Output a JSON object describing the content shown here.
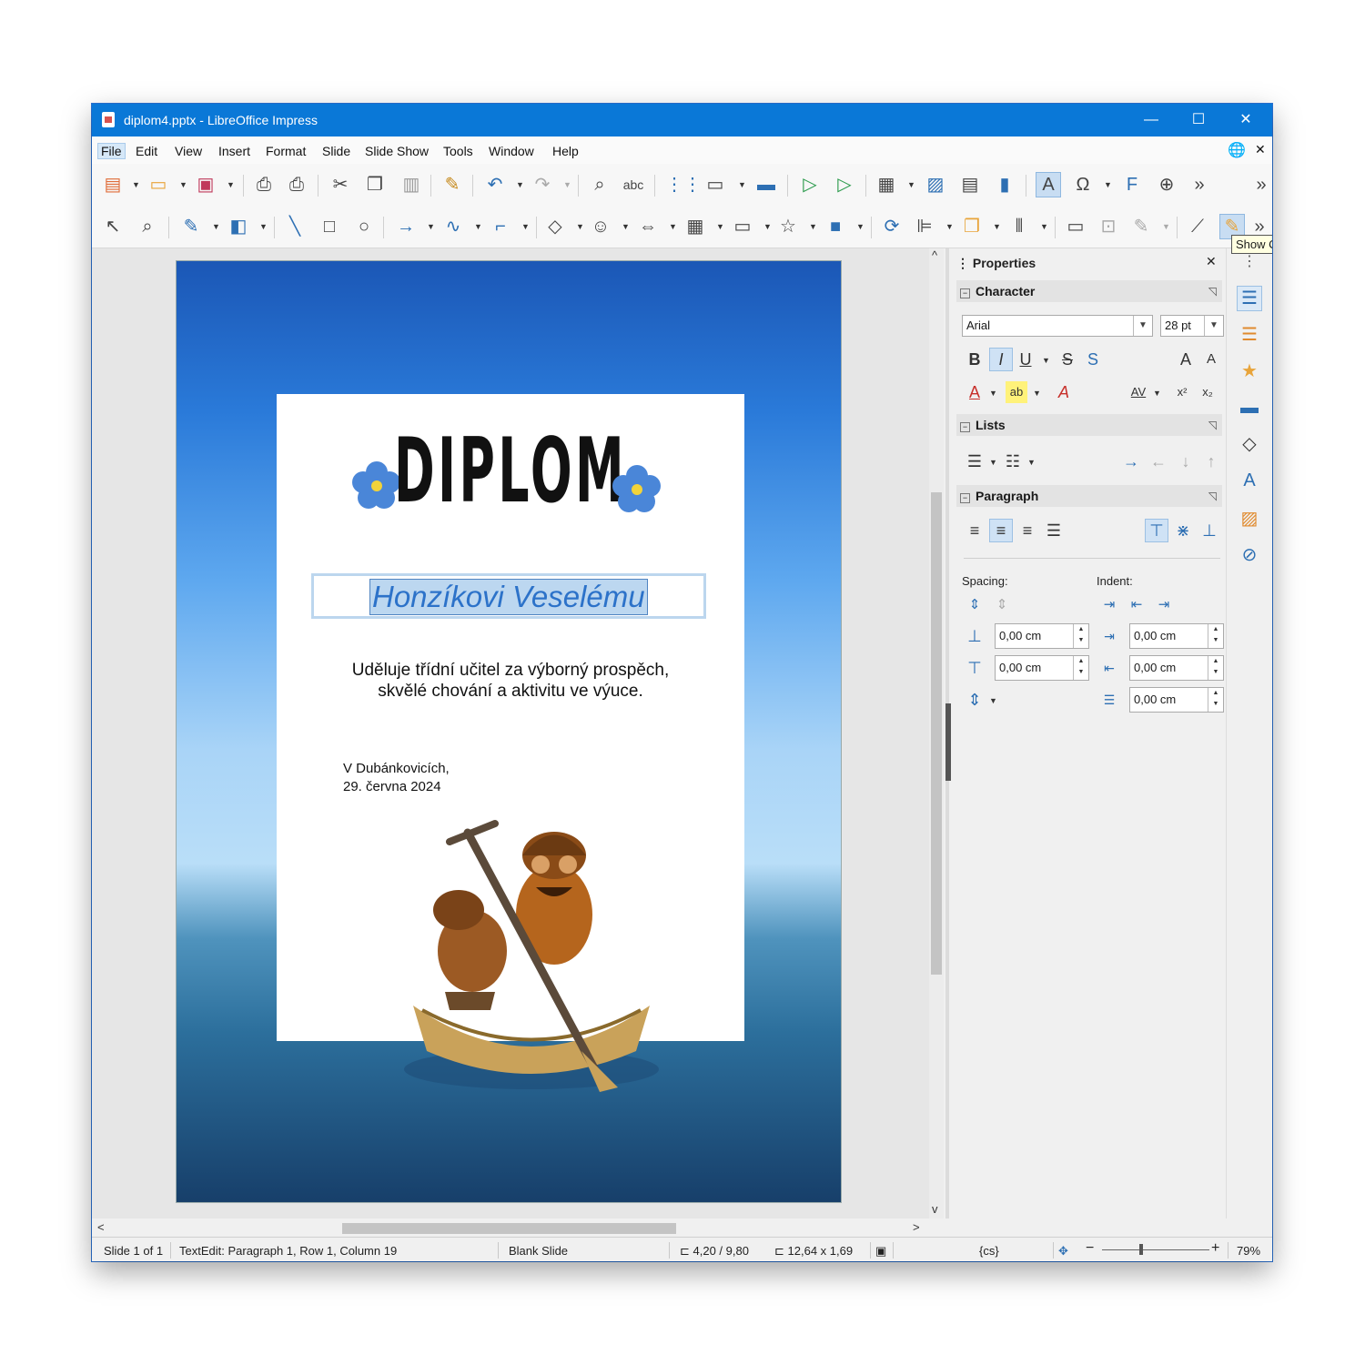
{
  "window": {
    "title": "diplom4.pptx - LibreOffice Impress",
    "minimize": "—",
    "maximize": "☐",
    "close": "✕"
  },
  "menu": {
    "items": [
      "File",
      "Edit",
      "View",
      "Insert",
      "Format",
      "Slide",
      "Slide Show",
      "Tools",
      "Window",
      "Help"
    ],
    "globe": "🌐",
    "close": "✕"
  },
  "toolbar_overflow": "»",
  "slide": {
    "title": "DIPLOM",
    "name": "Honzíkovi Veselému",
    "award_line1": "Uděluje třídní učitel za výborný prospěch,",
    "award_line2": "skvělé chování a aktivitu ve výuce.",
    "place": "V Dubánkovicích,",
    "date": "29. června 2024"
  },
  "sidebar": {
    "title": "Properties",
    "character": {
      "heading": "Character",
      "font_name": "Arial",
      "font_size": "28 pt",
      "bold": "B",
      "italic": "I",
      "underline": "U",
      "strike": "S",
      "shadow": "S",
      "grow": "A",
      "shrink": "A",
      "font_color": "A",
      "highlight": "ab",
      "clear": "A",
      "spacing": "AV",
      "superscript": "x²",
      "subscript": "x₂"
    },
    "lists": {
      "heading": "Lists"
    },
    "paragraph": {
      "heading": "Paragraph",
      "spacing_label": "Spacing:",
      "indent_label": "Indent:",
      "above": "0,00 cm",
      "below": "0,00 cm",
      "before_text": "0,00 cm",
      "after_text": "0,00 cm",
      "first_line": "0,00 cm"
    }
  },
  "tooltip": "Show Changes",
  "status": {
    "slide": "Slide 1 of 1",
    "edit": "TextEdit: Paragraph 1, Row 1, Column 19",
    "layout": "Blank Slide",
    "position": "4,20 / 9,80",
    "size": "12,64 x 1,69",
    "language": "{cs}",
    "zoom": "79%"
  }
}
